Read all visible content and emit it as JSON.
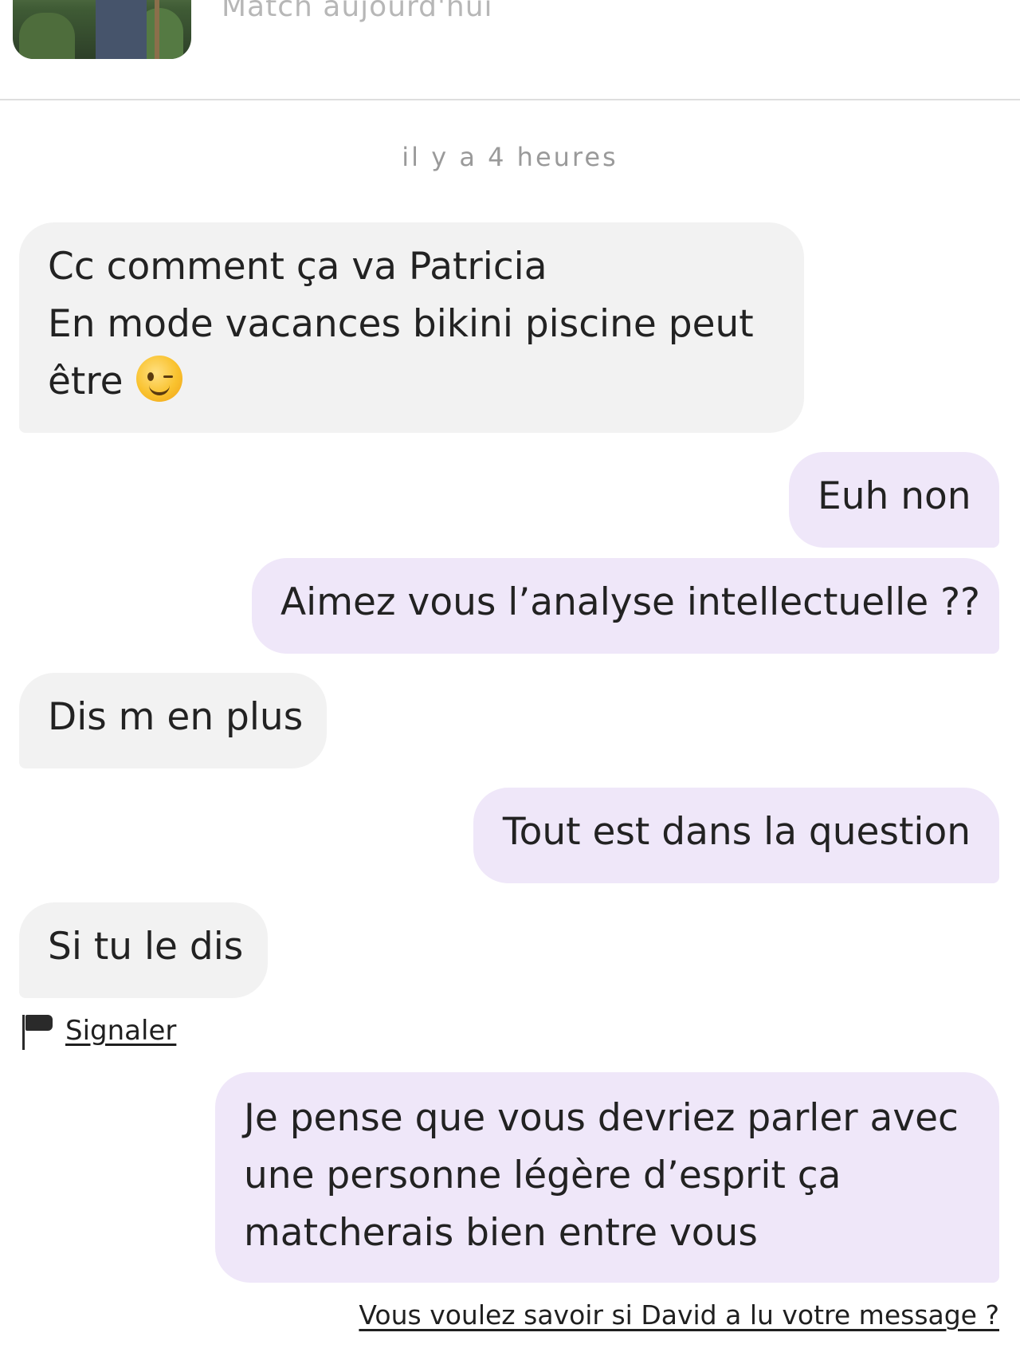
{
  "header": {
    "match_text": "Match aujourd'hui"
  },
  "conversation": {
    "timestamp": "il y a 4 heures",
    "messages": [
      {
        "direction": "incoming",
        "lines": [
          "Cc comment ça va Patricia",
          "En mode vacances bikini piscine peut",
          "être"
        ],
        "emoji": "winking-face"
      },
      {
        "direction": "outgoing",
        "lines": [
          "Euh non"
        ]
      },
      {
        "direction": "outgoing",
        "lines": [
          "Aimez vous l’analyse intellectuelle ??"
        ]
      },
      {
        "direction": "incoming",
        "lines": [
          "Dis m en plus"
        ]
      },
      {
        "direction": "outgoing",
        "lines": [
          "Tout est dans la question"
        ]
      },
      {
        "direction": "incoming",
        "lines": [
          "Si tu le dis"
        ]
      },
      {
        "direction": "outgoing",
        "lines": [
          "Je pense que vous devriez parler avec",
          "une personne légère d’esprit ça",
          "matcherais bien entre vous"
        ]
      }
    ]
  },
  "actions": {
    "report_label": "Signaler",
    "report_icon": "flag-icon",
    "read_receipt_link": "Vous voulez savoir si David a lu votre message ?"
  }
}
